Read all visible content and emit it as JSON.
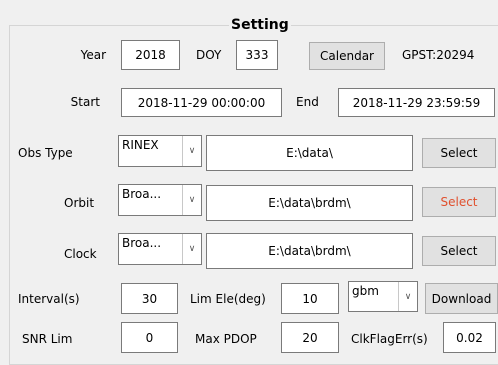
{
  "group": {
    "title": "Setting"
  },
  "date": {
    "year_label": "Year",
    "year_value": "2018",
    "doy_label": "DOY",
    "doy_value": "333",
    "calendar_button": "Calendar",
    "gpst_text": "GPST:20294"
  },
  "time": {
    "start_label": "Start",
    "start_value": "2018-11-29 00:00:00",
    "end_label": "End",
    "end_value": "2018-11-29 23:59:59"
  },
  "obs": {
    "label": "Obs Type",
    "type_selected": "RINEX",
    "path": "E:\\data\\",
    "select_button": "Select"
  },
  "orbit": {
    "label": "Orbit",
    "type_selected": "Broa...",
    "path": "E:\\data\\brdm\\",
    "select_button": "Select",
    "select_color": "#e0502e"
  },
  "clock": {
    "label": "Clock",
    "type_selected": "Broa...",
    "path": "E:\\data\\brdm\\",
    "select_button": "Select"
  },
  "params": {
    "interval_label": "Interval(s)",
    "interval_value": "30",
    "lim_ele_label": "Lim Ele(deg)",
    "lim_ele_value": "10",
    "source_selected": "gbm",
    "download_button": "Download",
    "snr_label": "SNR Lim",
    "snr_value": "0",
    "pdop_label": "Max PDOP",
    "pdop_value": "20",
    "clk_label": "ClkFlagErr(s)",
    "clk_value": "0.02"
  },
  "icons": {
    "dropdown": "chevron-down-icon"
  }
}
